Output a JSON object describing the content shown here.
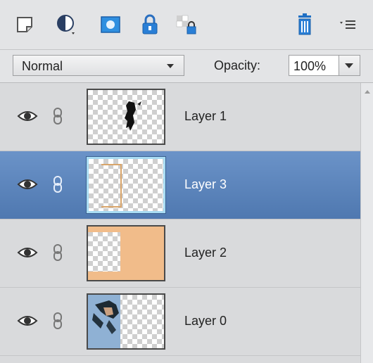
{
  "toolbar": {
    "icons": [
      "new-layer-icon",
      "adjustment-layer-icon",
      "layer-mask-icon",
      "lock-all-icon",
      "lock-transparency-icon",
      "trash-icon",
      "panel-menu-icon"
    ]
  },
  "blend": {
    "mode": "Normal",
    "opacity_label": "Opacity:",
    "opacity_value": "100%"
  },
  "layers": [
    {
      "name": "Layer 1",
      "selected": false
    },
    {
      "name": "Layer 3",
      "selected": true
    },
    {
      "name": "Layer 2",
      "selected": false
    },
    {
      "name": "Layer 0",
      "selected": false
    }
  ],
  "colors": {
    "selection": "#5a84bc",
    "layer2_fill": "#f1bc8a",
    "accent_blue": "#1f7ad0"
  }
}
